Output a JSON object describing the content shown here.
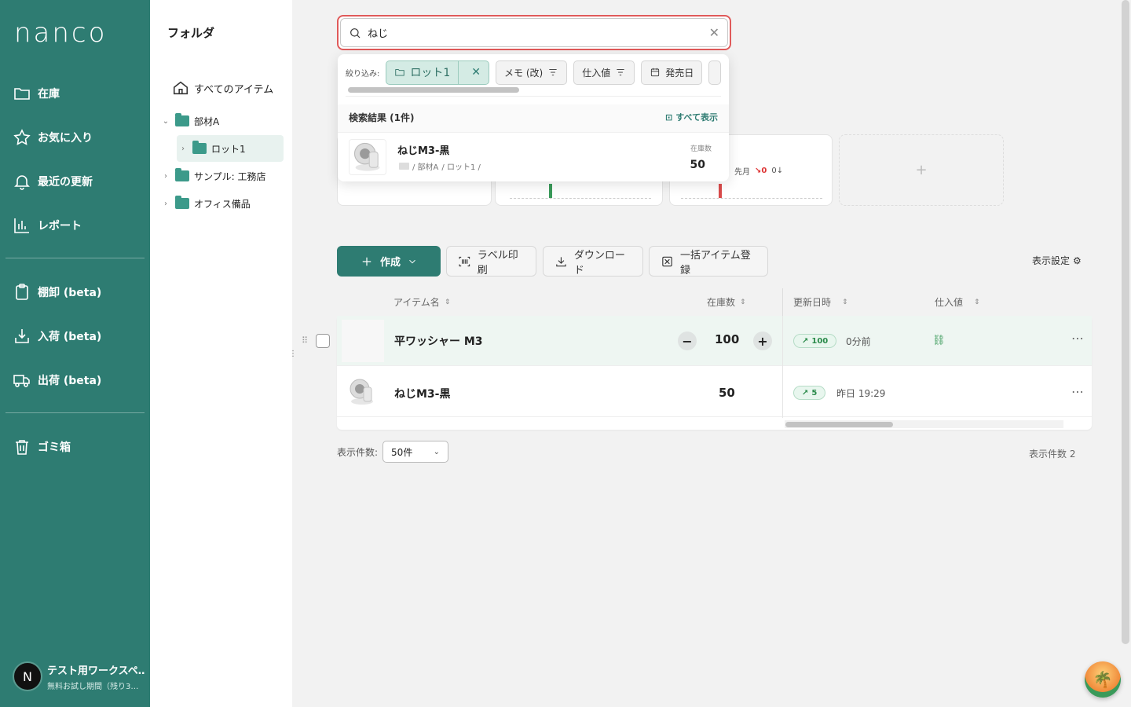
{
  "brand": {
    "logo": "nanco",
    "accent": "#2e7c72"
  },
  "sidebar": {
    "items": [
      {
        "label": "在庫",
        "icon": "folder-icon"
      },
      {
        "label": "お気に入り",
        "icon": "star-icon"
      },
      {
        "label": "最近の更新",
        "icon": "bell-icon"
      },
      {
        "label": "レポート",
        "icon": "bar-chart-icon"
      },
      {
        "label": "棚卸 (beta)",
        "icon": "clipboard-icon"
      },
      {
        "label": "入荷 (beta)",
        "icon": "inbox-download-icon"
      },
      {
        "label": "出荷 (beta)",
        "icon": "truck-icon"
      },
      {
        "label": "ゴミ箱",
        "icon": "trash-icon"
      }
    ],
    "workspace": {
      "avatar": "N",
      "name": "テスト用ワークスペ…",
      "sub": "無料お試し期間（残り3…"
    }
  },
  "folders": {
    "title": "フォルダ",
    "all_items": "すべてのアイテム",
    "tree": [
      {
        "label": "部材A"
      },
      {
        "label": "ロット1"
      },
      {
        "label": "サンプル: 工務店"
      },
      {
        "label": "オフィス備品"
      }
    ]
  },
  "search": {
    "value": "ねじ",
    "filter_label": "絞り込み:",
    "chips": {
      "active": "ロット1",
      "memo": "メモ (改)",
      "price": "仕入値",
      "release": "発売日"
    },
    "results_title": "検索結果 (1件)",
    "show_all": "すべて表示",
    "result": {
      "name": "ねじM3-黒",
      "path_a": "/ 部材A",
      "path_b": "/ ロット1 /",
      "qty_label": "在庫数",
      "qty": "50"
    }
  },
  "toolbar": {
    "create": "作成",
    "label_print": "ラベル印刷",
    "download": "ダウンロード",
    "bulk_register": "一括アイテム登録",
    "display_settings": "表示設定"
  },
  "table": {
    "headers": {
      "name": "アイテム名",
      "qty": "在庫数",
      "updated": "更新日時",
      "price": "仕入値"
    },
    "rows": [
      {
        "name": "平ワッシャー M3",
        "qty": "100",
        "badge": "100",
        "time": "0分前"
      },
      {
        "name": "ねじM3-黒",
        "qty": "50",
        "badge": "5",
        "time": "昨日 19:29"
      }
    ]
  },
  "pagination": {
    "per_page_label": "表示件数:",
    "per_page": "50件",
    "total": "表示件数 2"
  },
  "stat_fragment": {
    "last_month": "先月",
    "down_value": "0",
    "neutral": "0"
  }
}
